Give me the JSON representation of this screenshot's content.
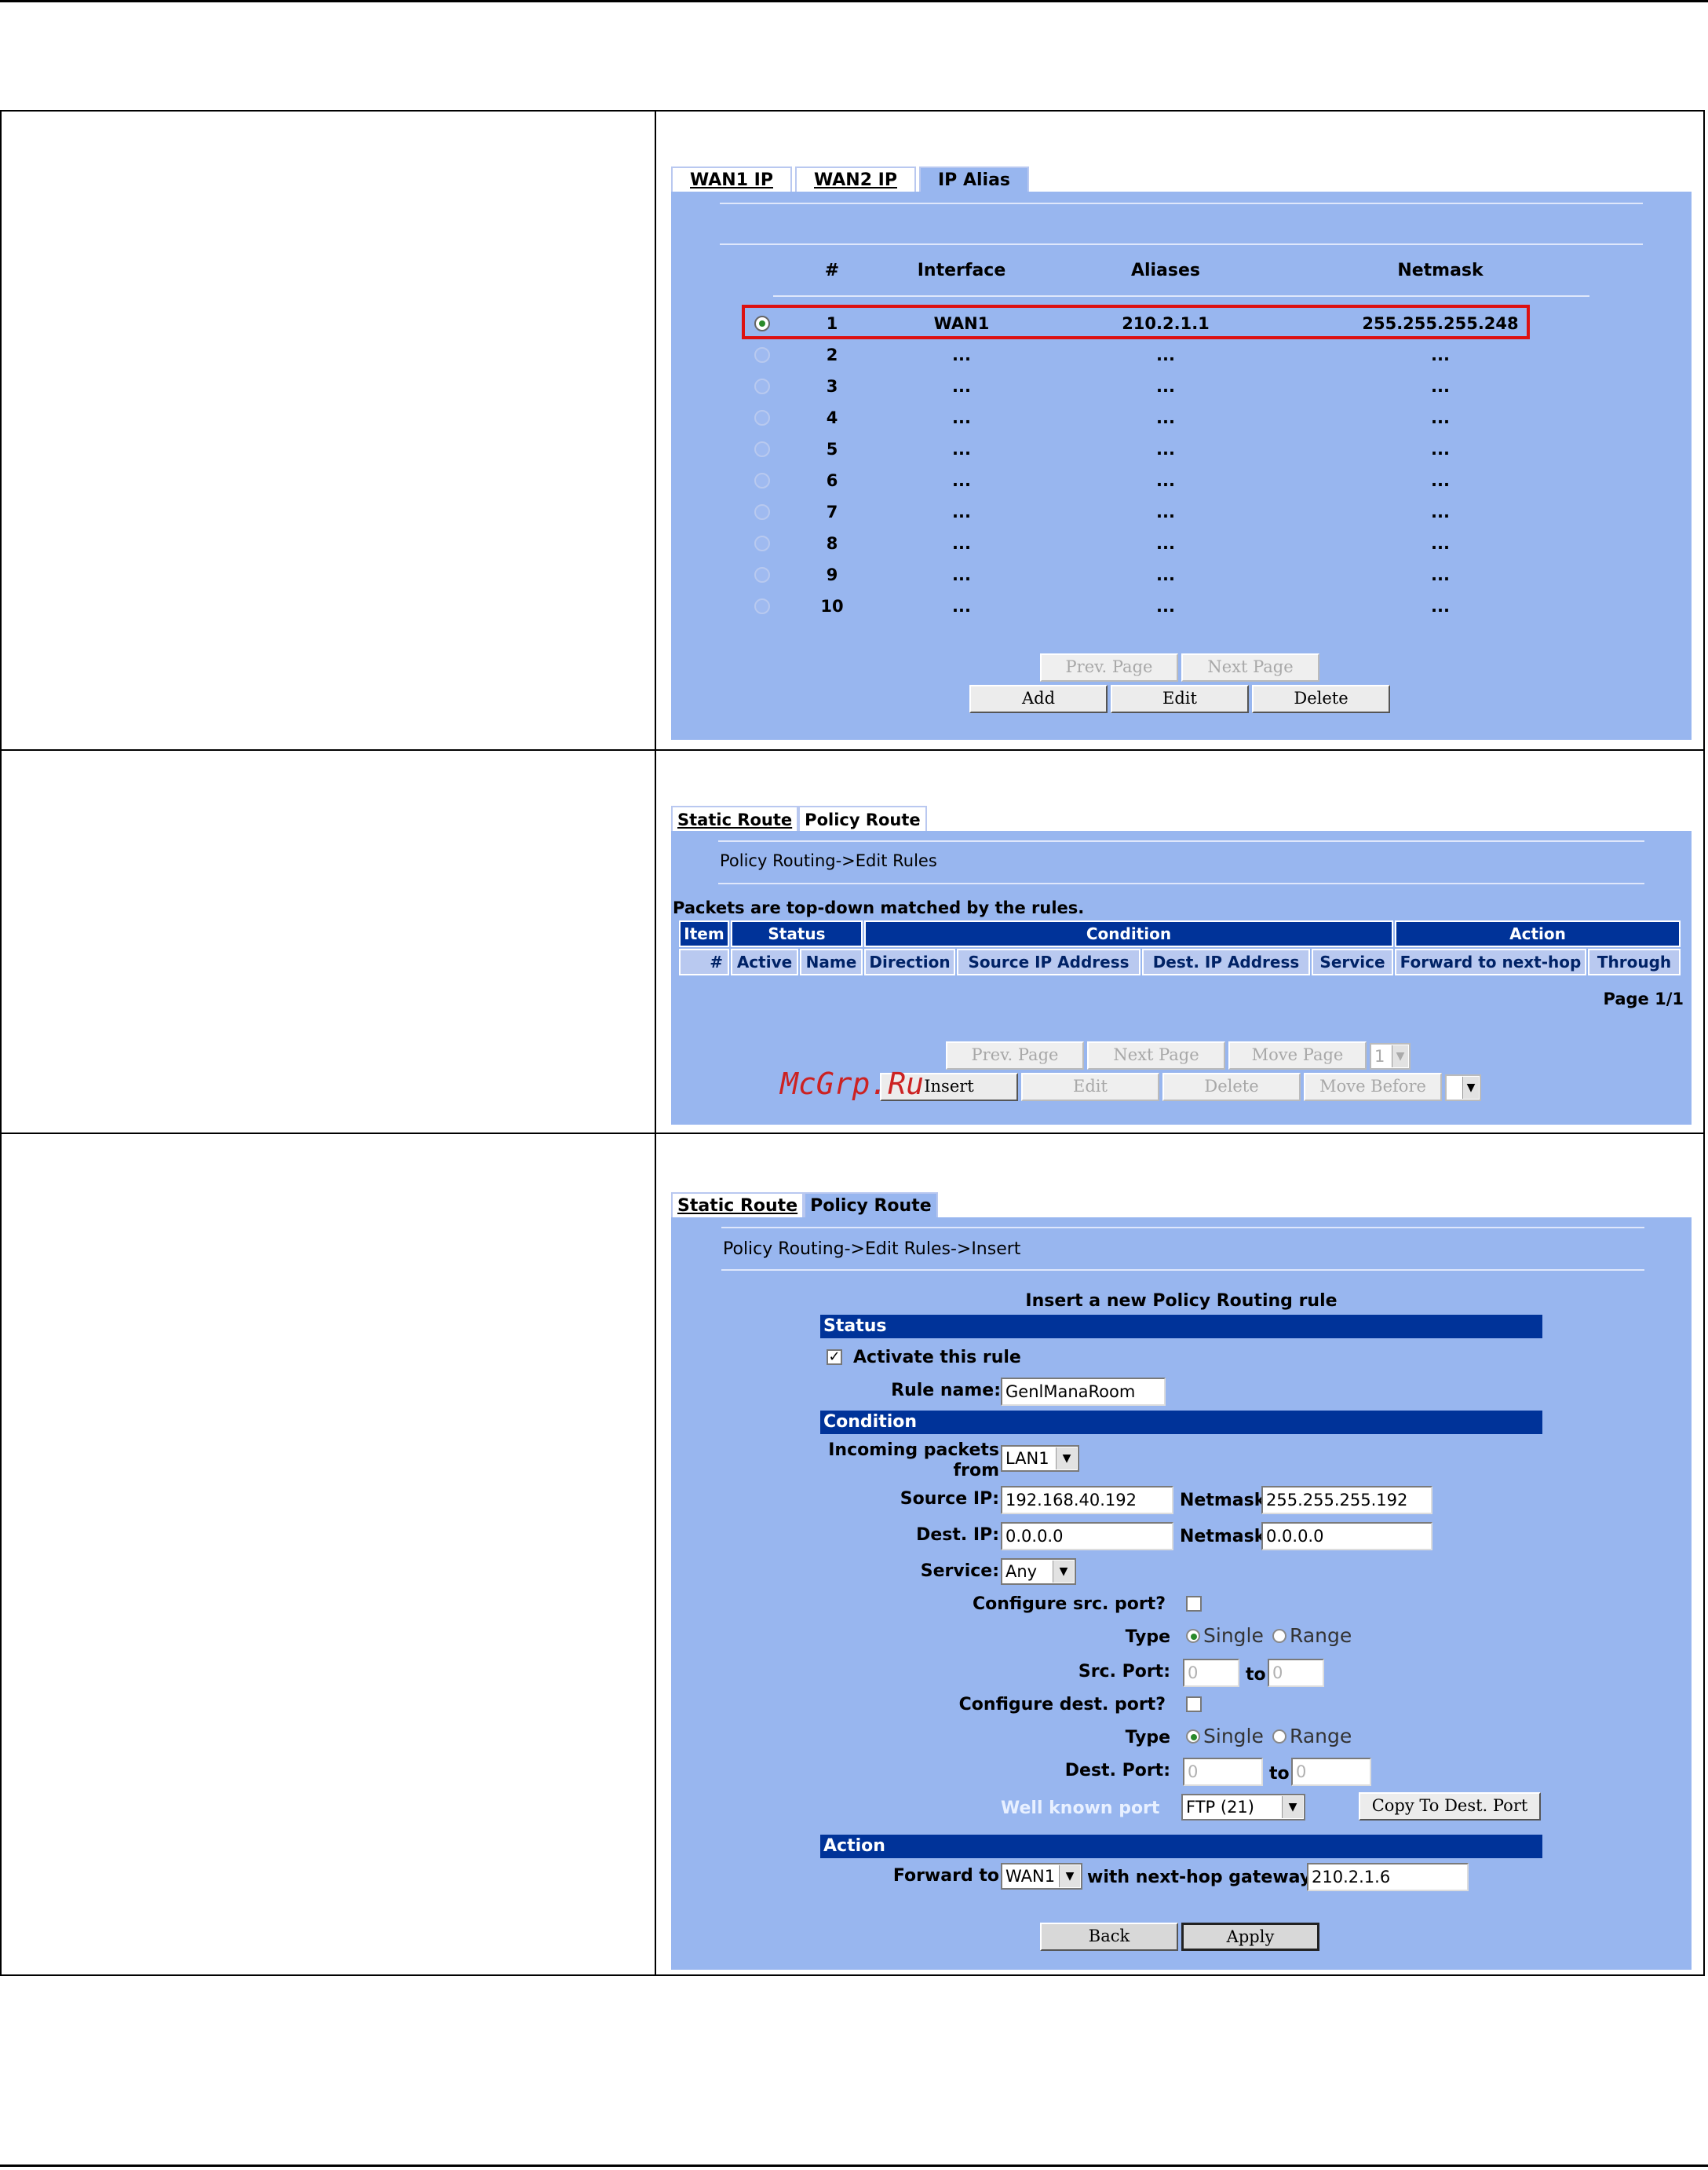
{
  "panel1": {
    "tabs": [
      "WAN1 IP",
      "WAN2 IP",
      "IP Alias"
    ],
    "columns": [
      "#",
      "Interface",
      "Aliases",
      "Netmask"
    ],
    "rows": [
      {
        "num": "1",
        "interface": "WAN1",
        "alias": "210.2.1.1",
        "netmask": "255.255.255.248",
        "selected": true
      },
      {
        "num": "2",
        "interface": "...",
        "alias": "...",
        "netmask": "..."
      },
      {
        "num": "3",
        "interface": "...",
        "alias": "...",
        "netmask": "..."
      },
      {
        "num": "4",
        "interface": "...",
        "alias": "...",
        "netmask": "..."
      },
      {
        "num": "5",
        "interface": "...",
        "alias": "...",
        "netmask": "..."
      },
      {
        "num": "6",
        "interface": "...",
        "alias": "...",
        "netmask": "..."
      },
      {
        "num": "7",
        "interface": "...",
        "alias": "...",
        "netmask": "..."
      },
      {
        "num": "8",
        "interface": "...",
        "alias": "...",
        "netmask": "..."
      },
      {
        "num": "9",
        "interface": "...",
        "alias": "...",
        "netmask": "..."
      },
      {
        "num": "10",
        "interface": "...",
        "alias": "...",
        "netmask": "..."
      }
    ],
    "prev_page": "Prev. Page",
    "next_page": "Next Page",
    "add": "Add",
    "edit": "Edit",
    "delete": "Delete"
  },
  "panel2": {
    "tabs": [
      "Static Route",
      "Policy Route"
    ],
    "breadcrumb": "Policy Routing->Edit Rules",
    "note": "Packets are top-down matched by the rules.",
    "group_headers": [
      "Item",
      "Status",
      "Condition",
      "Action"
    ],
    "columns": [
      "#",
      "Active",
      "Name",
      "Direction",
      "Source IP Address",
      "Dest. IP Address",
      "Service",
      "Forward to next-hop",
      "Through"
    ],
    "page": "Page 1/1",
    "prev_page": "Prev. Page",
    "next_page": "Next Page",
    "move_page": "Move Page",
    "page_select": "1",
    "insert": "Insert",
    "edit": "Edit",
    "delete": "Delete",
    "move_before": "Move Before"
  },
  "watermark": "McGrp.Ru",
  "panel3": {
    "tabs": [
      "Static Route",
      "Policy Route"
    ],
    "breadcrumb": "Policy Routing->Edit Rules->Insert",
    "title": "Insert a new Policy Routing rule",
    "status_header": "Status",
    "activate_label": "Activate this rule",
    "rule_name_label": "Rule name:",
    "rule_name_value": "GenlManaRoom",
    "condition_header": "Condition",
    "incoming_label_1": "Incoming packets",
    "incoming_label_2": "from",
    "incoming_value": "LAN1",
    "source_ip_label": "Source IP:",
    "source_ip_value": "192.168.40.192",
    "netmask_label": "Netmask:",
    "source_netmask_value": "255.255.255.192",
    "dest_ip_label": "Dest. IP:",
    "dest_ip_value": "0.0.0.0",
    "dest_netmask_value": "0.0.0.0",
    "service_label": "Service:",
    "service_value": "Any",
    "config_src_label": "Configure src. port?",
    "type_label": "Type",
    "single_label": "Single",
    "range_label": "Range",
    "src_port_label": "Src. Port:",
    "to_label": "to",
    "port_value": "0",
    "config_dest_label": "Configure dest. port?",
    "dest_port_label": "Dest. Port:",
    "well_known_label": "Well known port",
    "well_known_value": "FTP (21)",
    "copy_button": "Copy To Dest. Port",
    "action_header": "Action",
    "forward_label": "Forward to",
    "forward_value": "WAN1",
    "gateway_label": "with next-hop gateway IP",
    "gateway_value": "210.2.1.6",
    "back": "Back",
    "apply": "Apply"
  },
  "colors": {
    "panel_blue": "#98b6ef",
    "header_navy": "#003399",
    "highlight_red": "#dd1111",
    "watermark_red": "#cc2222",
    "well_known_text": "#e8f0ff"
  }
}
